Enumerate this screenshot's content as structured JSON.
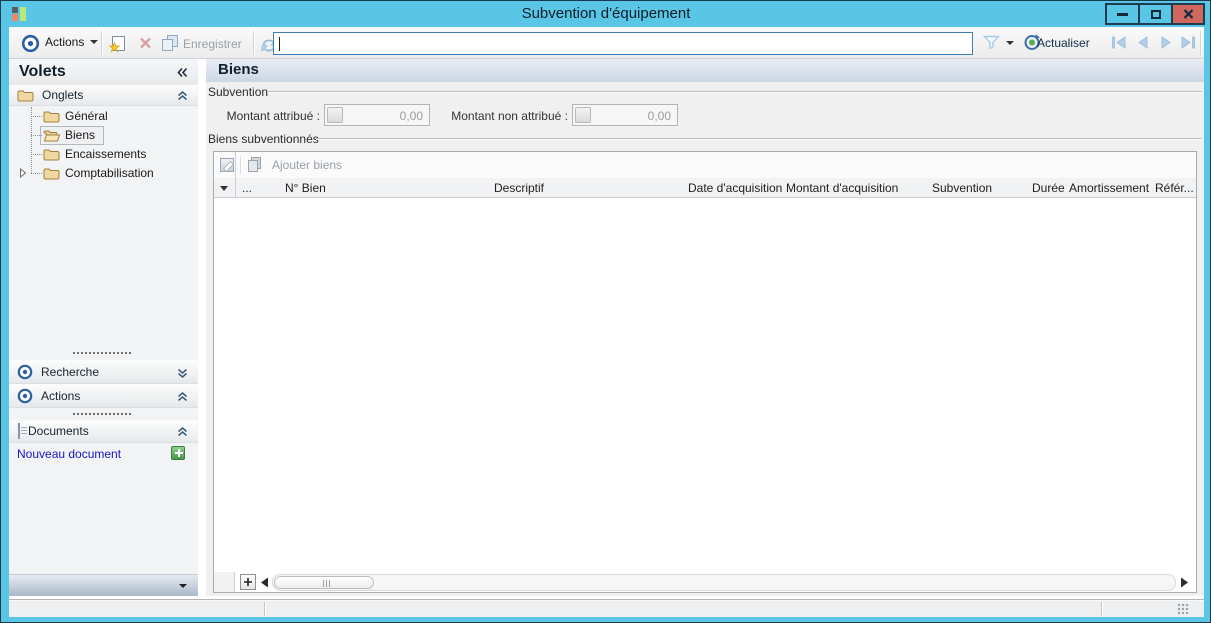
{
  "window": {
    "title": "Subvention d'équipement"
  },
  "toolbar": {
    "actions_label": "Actions",
    "save_label": "Enregistrer",
    "refresh_label": "Actualiser",
    "search_value": ""
  },
  "sidebar": {
    "title": "Volets",
    "groups": {
      "onglets": "Onglets",
      "recherche": "Recherche",
      "actions": "Actions",
      "documents": "Documents"
    },
    "tree": [
      {
        "label": "Général",
        "selected": false
      },
      {
        "label": "Biens",
        "selected": true
      },
      {
        "label": "Encaissements",
        "selected": false
      },
      {
        "label": "Comptabilisation",
        "selected": false
      }
    ],
    "new_document_label": "Nouveau document"
  },
  "main": {
    "title": "Biens",
    "subvention": {
      "label": "Subvention",
      "fields": [
        {
          "label": "Montant attribué :",
          "value": "0,00"
        },
        {
          "label": "Montant non attribué :",
          "value": "0,00"
        }
      ]
    },
    "biens": {
      "label": "Biens subventionnés",
      "add_button_label": "Ajouter biens",
      "columns": [
        {
          "label": "..."
        },
        {
          "label": "N° Bien"
        },
        {
          "label": "Descriptif"
        },
        {
          "label": "Date d'acquisition"
        },
        {
          "label": "Montant d'acquisition"
        },
        {
          "label": "Subvention"
        },
        {
          "label": "Durée"
        },
        {
          "label": "Amortissement"
        },
        {
          "label": "Référ..."
        }
      ],
      "rows": []
    }
  },
  "icons": {
    "window": [
      "minimize-icon",
      "maximize-icon",
      "close-icon"
    ],
    "toolbar": [
      "target-icon",
      "new-document-icon",
      "delete-icon",
      "save-icon",
      "refresh-arrows-icon",
      "filter-icon",
      "actualiser-icon",
      "nav-first-icon",
      "nav-prev-icon",
      "nav-next-icon",
      "nav-last-icon"
    ],
    "sidebar": [
      "collapse-left-icon",
      "folder-icon",
      "folder-open-icon",
      "chevron-double-up-icon",
      "chevron-double-down-icon",
      "target-icon",
      "document-icon",
      "add-icon"
    ],
    "table": [
      "edit-cell-icon",
      "documents-stack-icon",
      "column-dropdown-icon",
      "add-row-icon",
      "scroll-left-icon",
      "scroll-right-icon"
    ]
  },
  "colors": {
    "titlebar_blue": "#5ac6e6",
    "close_button_red": "#d0685e",
    "link_blue": "#1616c8",
    "accent_blue": "#2d5fa6"
  }
}
